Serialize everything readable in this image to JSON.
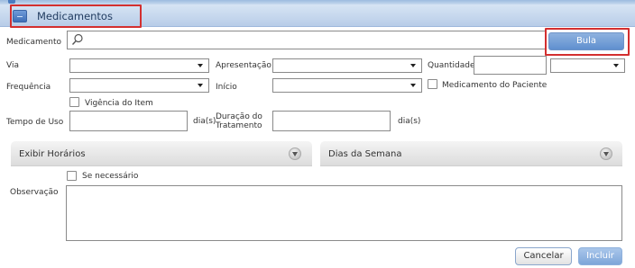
{
  "section": {
    "title": "Medicamentos",
    "collapse_icon": "minus-icon"
  },
  "fields": {
    "medicamento": {
      "label": "Medicamento",
      "value": "",
      "icon": "search-icon"
    },
    "via": {
      "label": "Via",
      "selected": ""
    },
    "apresentacao": {
      "label": "Apresentação",
      "selected": ""
    },
    "quantidade": {
      "label": "Quantidade",
      "value": "",
      "unit_selected": ""
    },
    "frequencia": {
      "label": "Frequência",
      "selected": ""
    },
    "inicio": {
      "label": "Início",
      "selected": ""
    },
    "medicamento_paciente": {
      "label": "Medicamento do Paciente",
      "checked": false
    },
    "vigencia": {
      "label": "Vigência do Item",
      "checked": false
    },
    "tempo_uso": {
      "label": "Tempo de Uso",
      "value": "",
      "unit": "dia(s)"
    },
    "duracao": {
      "label_line1": "Duração do",
      "label_line2": "Tratamento",
      "value": "",
      "unit": "dia(s)"
    },
    "se_necessario": {
      "label": "Se necessário",
      "checked": false
    },
    "observacao": {
      "label": "Observação",
      "value": ""
    }
  },
  "panels": {
    "exibir_horarios": {
      "title": "Exibir Horários",
      "icon": "chevron-down-icon"
    },
    "dias_semana": {
      "title": "Dias da Semana",
      "icon": "chevron-down-icon"
    }
  },
  "buttons": {
    "bula": "Bula",
    "cancelar": "Cancelar",
    "incluir": "Incluir"
  },
  "colors": {
    "header_blue": "#b8cde8",
    "accent_blue": "#5f8fcf",
    "highlight_red": "#d32f2f"
  }
}
